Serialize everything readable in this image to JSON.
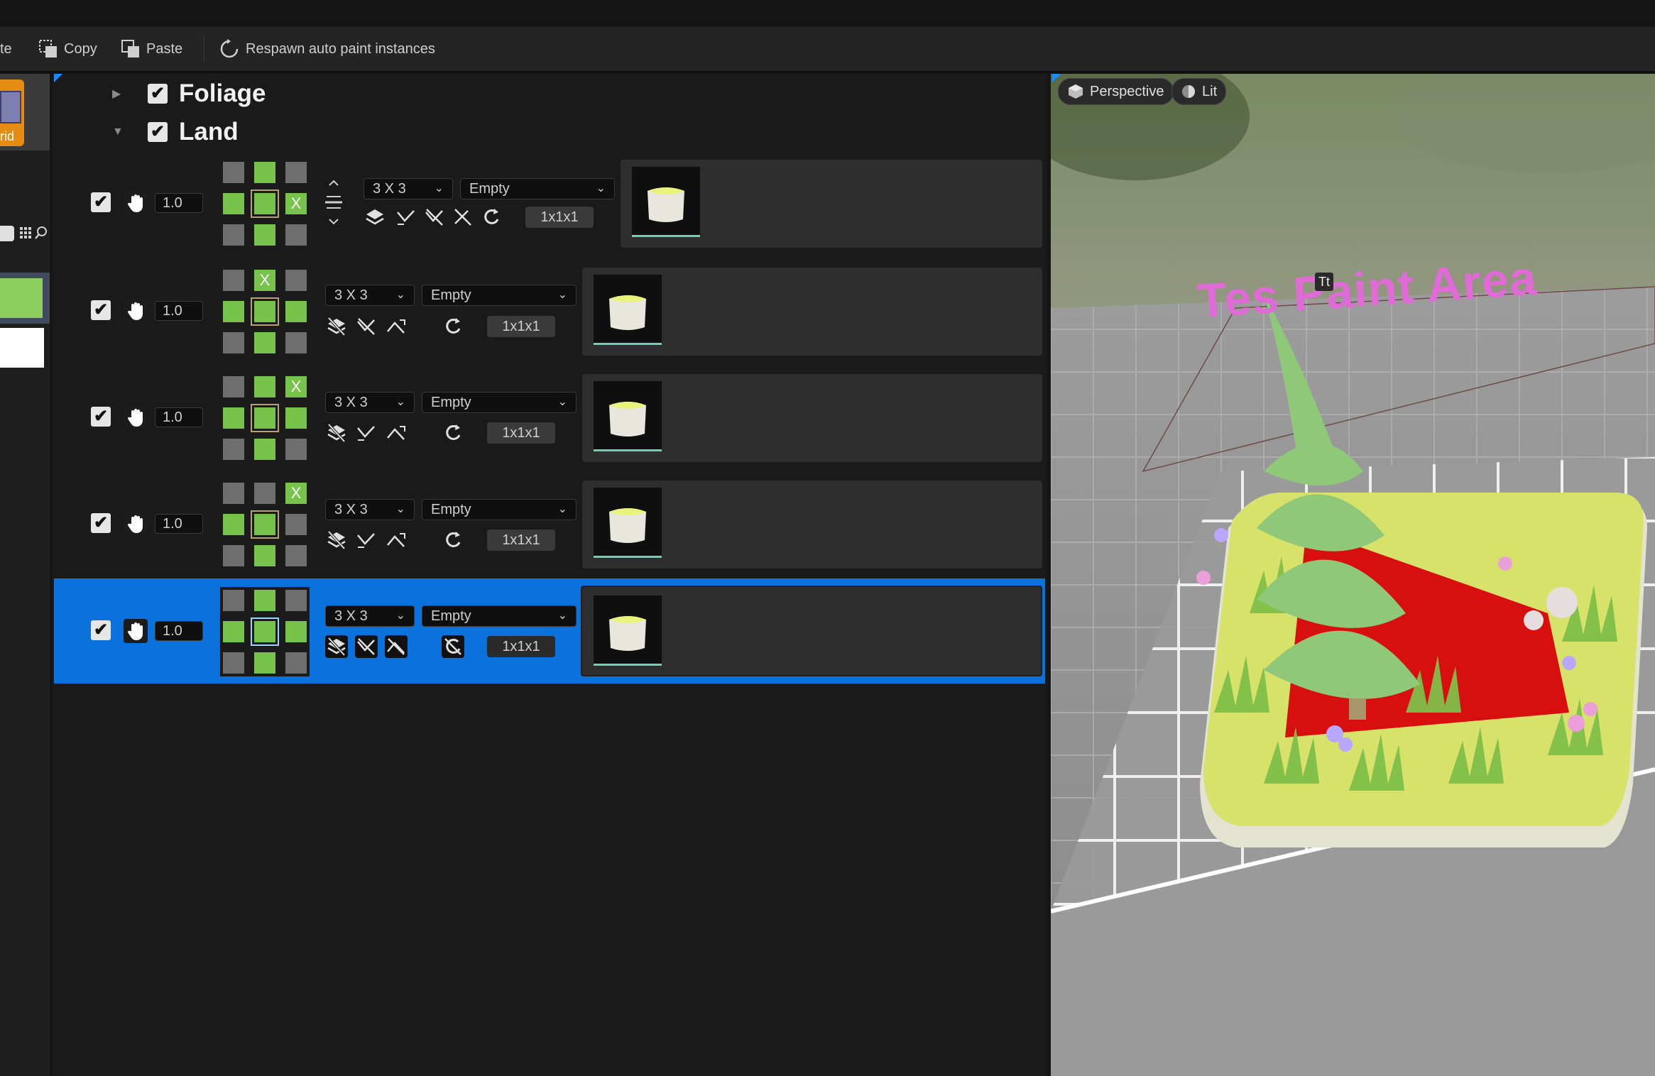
{
  "toolbar": {
    "partial_label": "te",
    "copy_label": "Copy",
    "paste_label": "Paste",
    "respawn_label": "Respawn auto paint instances"
  },
  "left_strip": {
    "grid_button_label": "rid"
  },
  "categories": [
    {
      "label": "Foliage",
      "checked": true,
      "expanded": false
    },
    {
      "label": "Land",
      "checked": true,
      "expanded": true
    }
  ],
  "rules": [
    {
      "enabled": true,
      "weight": "1.0",
      "pattern": "3 X 3",
      "mode": "Empty",
      "size": "1x1x1",
      "selected": false
    },
    {
      "enabled": true,
      "weight": "1.0",
      "pattern": "3 X 3",
      "mode": "Empty",
      "size": "1x1x1",
      "selected": false
    },
    {
      "enabled": true,
      "weight": "1.0",
      "pattern": "3 X 3",
      "mode": "Empty",
      "size": "1x1x1",
      "selected": false
    },
    {
      "enabled": true,
      "weight": "1.0",
      "pattern": "3 X 3",
      "mode": "Empty",
      "size": "1x1x1",
      "selected": false
    },
    {
      "enabled": true,
      "weight": "1.0",
      "pattern": "3 X 3",
      "mode": "Empty",
      "size": "1x1x1",
      "selected": true
    }
  ],
  "checkmark": "✔",
  "neighbor_x": "X",
  "plus": "+",
  "viewport": {
    "perspective_label": "Perspective",
    "lit_label": "Lit",
    "scene_text": "Tes  Paint Area",
    "text_icon": "Tt"
  },
  "colors": {
    "selection": "#0b72dd",
    "neighbor_green": "#76c24a",
    "neighbor_gray": "#6e6e6e",
    "scene_text": "#e06ad6"
  }
}
